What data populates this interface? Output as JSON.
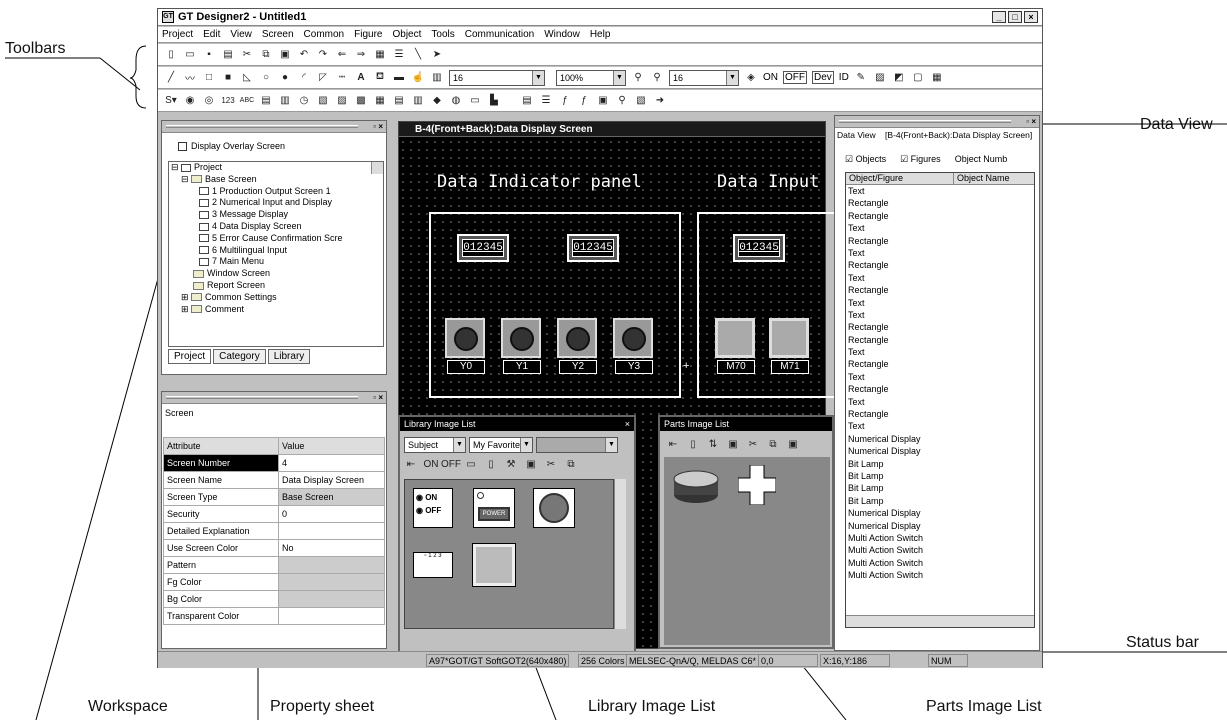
{
  "callouts": {
    "toolbars": "Toolbars",
    "data_view": "Data View",
    "status_bar": "Status bar",
    "workspace": "Workspace",
    "property_sheet": "Property sheet",
    "library_image_list": "Library Image List",
    "parts_image_list": "Parts Image List"
  },
  "window": {
    "title": "GT Designer2 - Untitled1",
    "buttons": [
      "_",
      "□",
      "×"
    ]
  },
  "menu": [
    "Project",
    "Edit",
    "View",
    "Screen",
    "Common",
    "Figure",
    "Object",
    "Tools",
    "Communication",
    "Window",
    "Help"
  ],
  "toolbar2": {
    "font_size": "16",
    "zoom": "100%",
    "font_size2": "16",
    "on": "ON",
    "off": "OFF",
    "dev": "Dev",
    "id": "ID"
  },
  "workspace": {
    "overlay_label": "Display Overlay Screen",
    "tree": [
      {
        "label": "Project",
        "level": 0,
        "kind": "root"
      },
      {
        "label": "Base Screen",
        "level": 1,
        "kind": "folder"
      },
      {
        "label": "1 Production Output Screen 1",
        "level": 2,
        "kind": "screen"
      },
      {
        "label": "2 Numerical Input and Display",
        "level": 2,
        "kind": "screen"
      },
      {
        "label": "3 Message Display",
        "level": 2,
        "kind": "screen"
      },
      {
        "label": "4 Data Display Screen",
        "level": 2,
        "kind": "screen"
      },
      {
        "label": "5 Error Cause Confirmation Scre",
        "level": 2,
        "kind": "screen"
      },
      {
        "label": "6 Multilingual Input",
        "level": 2,
        "kind": "screen"
      },
      {
        "label": "7 Main Menu",
        "level": 2,
        "kind": "screen"
      },
      {
        "label": "Window Screen",
        "level": 1,
        "kind": "folder"
      },
      {
        "label": "Report Screen",
        "level": 1,
        "kind": "folder"
      },
      {
        "label": "Common Settings",
        "level": 1,
        "kind": "folder"
      },
      {
        "label": "Comment",
        "level": 1,
        "kind": "folder"
      }
    ],
    "tabs": [
      "Project",
      "Category",
      "Library"
    ]
  },
  "property": {
    "title": "Screen",
    "header": [
      "Attribute",
      "Value"
    ],
    "rows": [
      [
        "Screen Number",
        "4"
      ],
      [
        "Screen Name",
        "Data Display Screen"
      ],
      [
        "Screen Type",
        "Base Screen"
      ],
      [
        "Security",
        "0"
      ],
      [
        "Detailed Explanation",
        ""
      ],
      [
        "Use Screen Color",
        "No"
      ],
      [
        "Pattern",
        ""
      ],
      [
        "Fg Color",
        ""
      ],
      [
        "Bg Color",
        ""
      ],
      [
        "Transparent Color",
        ""
      ]
    ]
  },
  "editor": {
    "title": "B-4(Front+Back):Data Display Screen",
    "heading1": "Data Indicator panel",
    "heading2": "Data Input",
    "num_displays": [
      "012345",
      "012345",
      "012345"
    ],
    "lamps": [
      "Y0",
      "Y1",
      "Y2",
      "Y3"
    ],
    "switches": [
      "M70",
      "M71"
    ],
    "plus": "+"
  },
  "library": {
    "title": "Library Image List",
    "close": "×",
    "category": "Subject",
    "favorites": "My Favorite",
    "items": [
      "ON",
      "OFF",
      "POWER"
    ]
  },
  "parts": {
    "title": "Parts Image List"
  },
  "dataview": {
    "label": "Data View",
    "screen": "[B-4(Front+Back):Data Display Screen]",
    "objects_cb": "Objects",
    "figures_cb": "Figures",
    "object_num": "Object Numb",
    "header": [
      "Object/Figure",
      "Object Name"
    ],
    "items": [
      "Text",
      "Rectangle",
      "Rectangle",
      "Text",
      "Rectangle",
      "Text",
      "Rectangle",
      "Text",
      "Rectangle",
      "Text",
      "Text",
      "Rectangle",
      "Rectangle",
      "Text",
      "Rectangle",
      "Text",
      "Rectangle",
      "Text",
      "Rectangle",
      "Text",
      "Numerical Display",
      "Numerical Display",
      "Bit Lamp",
      "Bit Lamp",
      "Bit Lamp",
      "Bit Lamp",
      "Numerical Display",
      "Numerical Display",
      "Multi Action Switch",
      "Multi Action Switch",
      "Multi Action Switch",
      "Multi Action Switch"
    ]
  },
  "status": {
    "gt": "A97*GOT/GT SoftGOT2(640x480)",
    "colors": "256 Colors",
    "plc": "MELSEC-QnA/Q, MELDAS C6*",
    "pos": "0,0",
    "xy": "X:16,Y:186",
    "num": "NUM"
  }
}
